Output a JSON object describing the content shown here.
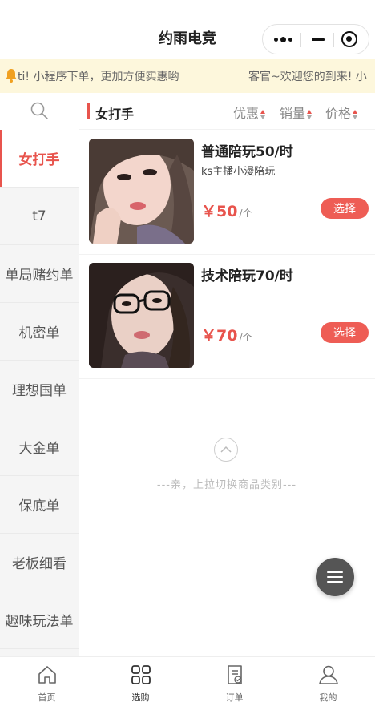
{
  "navbar": {
    "title": "约雨电竞"
  },
  "notice": {
    "text1": "ti! 小程序下单，更加方便实惠哟",
    "text2": "客官~欢迎您的到来! 小"
  },
  "sidebar": {
    "items": [
      {
        "label": "女打手",
        "active": true
      },
      {
        "label": "t7"
      },
      {
        "label": "单局赌约单"
      },
      {
        "label": "机密单"
      },
      {
        "label": "理想国单"
      },
      {
        "label": "大金单"
      },
      {
        "label": "保底单"
      },
      {
        "label": "老板细看"
      },
      {
        "label": "趣味玩法单"
      }
    ]
  },
  "main": {
    "category_title": "女打手",
    "sort": {
      "discount": "优惠",
      "sales": "销量",
      "price": "价格"
    },
    "products": [
      {
        "title": "普通陪玩50/时",
        "subtitle": "ks主播小漫陪玩",
        "price": "￥50",
        "unit": "/个",
        "button": "选择"
      },
      {
        "title": "技术陪玩70/时",
        "subtitle": "",
        "price": "￥70",
        "unit": "/个",
        "button": "选择"
      }
    ],
    "pull_hint": "---亲，上拉切换商品类别---"
  },
  "tabbar": {
    "items": [
      {
        "label": "首页"
      },
      {
        "label": "选购",
        "active": true
      },
      {
        "label": "订单"
      },
      {
        "label": "我的"
      }
    ]
  },
  "colors": {
    "accent": "#e8544d",
    "notice_bg": "#fdf7dc",
    "sidebar_bg": "#f5f5f5"
  }
}
